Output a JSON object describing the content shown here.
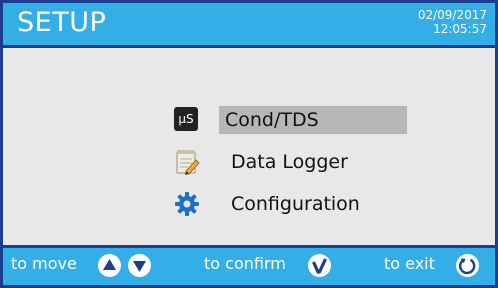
{
  "header": {
    "title": "SETUP",
    "date": "02/09/2017",
    "time": "12:05:57"
  },
  "menu": {
    "items": [
      {
        "label": "Cond/TDS",
        "icon": "microsiemens-icon",
        "icon_text": "µS",
        "selected": true
      },
      {
        "label": "Data Logger",
        "icon": "notepad-icon",
        "selected": false
      },
      {
        "label": "Configuration",
        "icon": "gear-icon",
        "selected": false
      }
    ]
  },
  "footer": {
    "move_label": "to move",
    "confirm_label": "to confirm",
    "exit_label": "to exit",
    "icons": [
      "up-arrow-icon",
      "down-arrow-icon",
      "checkmark-icon",
      "exit-circle-icon"
    ]
  },
  "colors": {
    "bar": "#34aee6",
    "border": "#1b3f8e",
    "background": "#e8e8e8",
    "selection": "#b7b7b7"
  }
}
